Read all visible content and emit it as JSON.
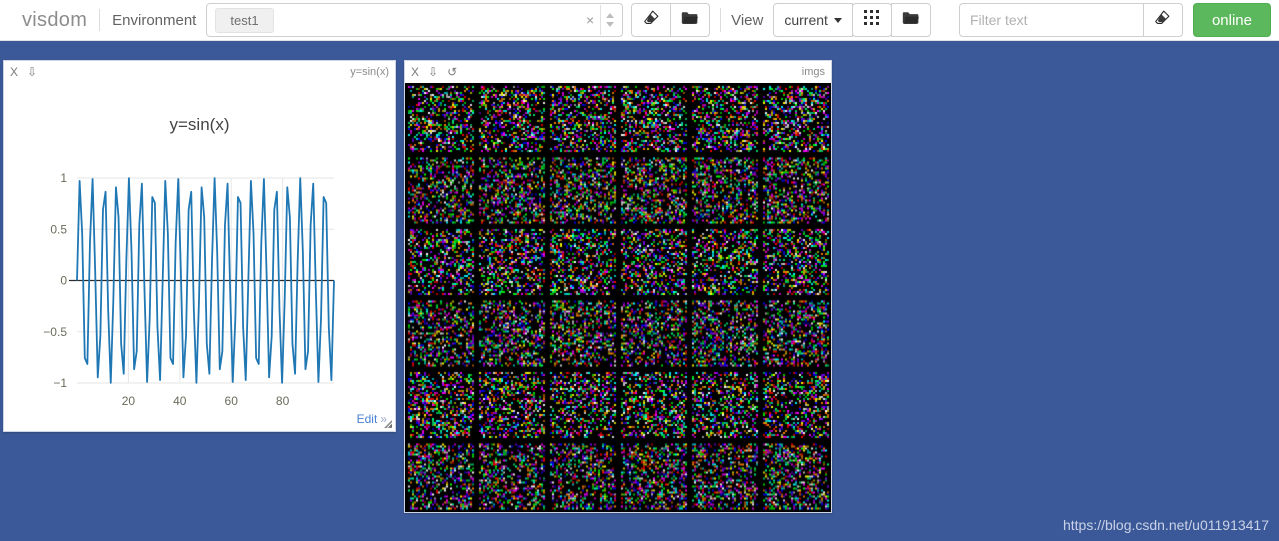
{
  "navbar": {
    "brand": "visdom",
    "env_label": "Environment",
    "env_value": "test1",
    "env_clear": "×",
    "clear_env_icon": "eraser-icon",
    "folder_icon": "folder-icon",
    "view_label": "View",
    "view_value": "current",
    "grid_icon": "grid-icon",
    "view_folder_icon": "folder-icon",
    "filter_placeholder": "Filter text",
    "filter_value": "",
    "filter_clear_icon": "eraser-icon",
    "status_label": "online",
    "status_color": "#5cb85c"
  },
  "panels": [
    {
      "id": "plot",
      "title": "y=sin(x)",
      "close_label": "X",
      "save_label": "⇩",
      "edit_label": "Edit",
      "edit_chevron": "»"
    },
    {
      "id": "imgs",
      "title": "imgs",
      "close_label": "X",
      "save_label": "⇩",
      "reset_label": "↺"
    }
  ],
  "chart_data": {
    "type": "line",
    "title": "y=sin(x)",
    "xlabel": "",
    "ylabel": "",
    "line_color": "#1f77b4",
    "grid": true,
    "legend": false,
    "xlim": [
      0,
      100
    ],
    "ylim": [
      -1,
      1
    ],
    "xticks": [
      20,
      40,
      60,
      80
    ],
    "yticks": [
      -1,
      -0.5,
      0,
      0.5,
      1
    ],
    "ytick_labels": [
      "−1",
      "−0.5",
      "0",
      "0.5",
      "1"
    ],
    "xtick_labels": [
      "20",
      "40",
      "60",
      "80"
    ],
    "series": [
      {
        "name": "y=sin(x)",
        "expression": "sin(x)",
        "n_points": 100,
        "x_start": 0,
        "x_end": 100,
        "cycles": 21
      }
    ]
  },
  "image_grid": {
    "type": "image-grid",
    "rows": 6,
    "cols": 6,
    "count": 36,
    "content": "random-rgb-noise",
    "background": "#000000"
  },
  "watermark": "https://blog.csdn.net/u011913417"
}
